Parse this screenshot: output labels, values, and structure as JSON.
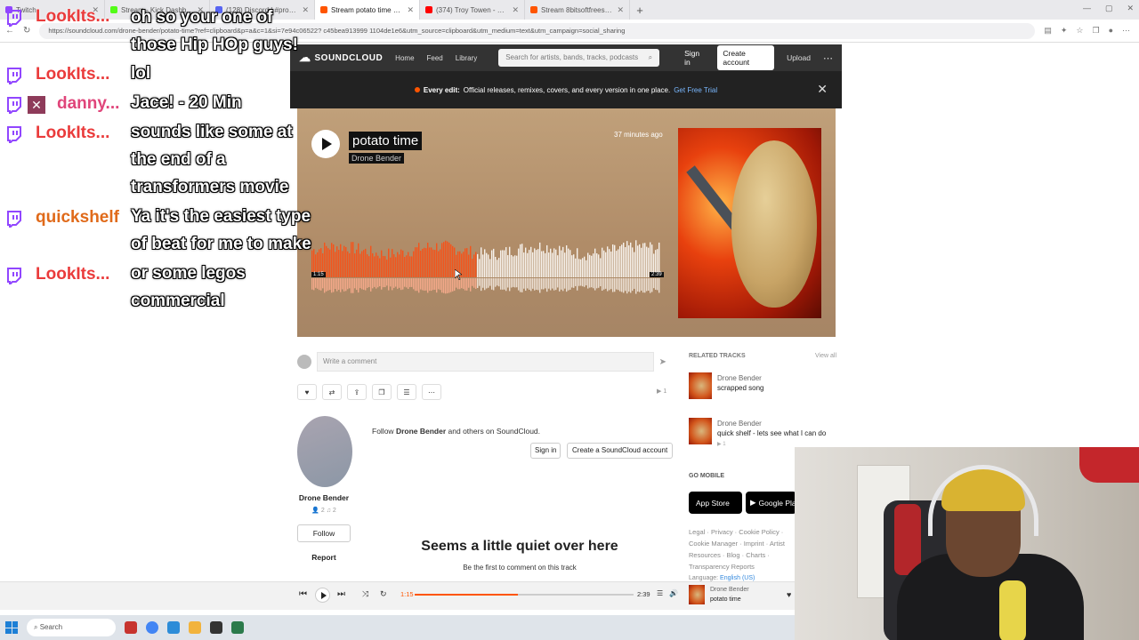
{
  "browser": {
    "tabs": [
      {
        "label": "Twitch",
        "color": "#9146ff",
        "active": false
      },
      {
        "label": "Stream - Kick Dashboard",
        "color": "#53fc18",
        "active": false
      },
      {
        "label": "(128) Discord | #promote-yourse",
        "color": "#5865f2",
        "active": false
      },
      {
        "label": "Stream potato time by Drone Ben",
        "color": "#f50",
        "active": true
      },
      {
        "label": "(374) Troy Towen - BAMBINA (Off",
        "color": "#ff0000",
        "active": false
      },
      {
        "label": "Stream 8bitsoftfreestyle by yungb",
        "color": "#f50",
        "active": false
      }
    ],
    "url": "https://soundcloud.com/drone-bender/potato-time?ref=clipboard&p=a&c=1&si=7e94c06522? c45bea913999 1104de1e6&utm_source=clipboard&utm_medium=text&utm_campaign=social_sharing"
  },
  "soundcloud": {
    "logo": "SOUNDCLOUD",
    "nav": [
      "Home",
      "Feed",
      "Library"
    ],
    "search_placeholder": "Search for artists, bands, tracks, podcasts",
    "signin": "Sign in",
    "create_account": "Create account",
    "upload": "Upload",
    "banner": {
      "bold": "Every edit:",
      "text": "Official releases, remixes, covers, and every version in one place.",
      "link": "Get Free Trial"
    },
    "track": {
      "title": "potato time",
      "artist": "Drone Bender",
      "posted": "37 minutes ago",
      "elapsed": "1:15",
      "duration": "2:39",
      "progress": 0.47
    },
    "comment_placeholder": "Write a comment",
    "plays": "▶ 1",
    "artist_name": "Drone Bender",
    "artist_stats": "👤 2   ♫ 2",
    "follow": "Follow",
    "report": "Report",
    "follow_msg_prefix": "Follow",
    "follow_msg_artist": "Drone Bender",
    "follow_msg_suffix": "and others on SoundCloud.",
    "signin_small": "Sign in",
    "create_sc": "Create a SoundCloud account",
    "quiet_title": "Seems a little quiet over here",
    "quiet_sub": "Be the first to comment on this track",
    "related_header": "RELATED TRACKS",
    "view_all": "View all",
    "related": [
      {
        "artist": "Drone Bender",
        "title": "scrapped song",
        "plays": ""
      },
      {
        "artist": "Drone Bender",
        "title": "quick shelf - lets see what I can do",
        "plays": "▶ 1"
      }
    ],
    "go_mobile": "GO MOBILE",
    "app_store": "App Store",
    "google_play": "Google Play",
    "footer_links": "Legal · Privacy · Cookie Policy · Cookie Manager · Imprint · Artist Resources · Blog · Charts · Transparency Reports",
    "language_label": "Language:",
    "language_value": "English (US)",
    "player_artist": "Drone Bender",
    "player_title": "potato time"
  },
  "chat": [
    {
      "user": "LookIts...",
      "user_color": "red",
      "lines": [
        "oh so your one of",
        "those Hip HOp guys!"
      ]
    },
    {
      "user": "LookIts...",
      "user_color": "red",
      "lines": [
        "lol"
      ]
    },
    {
      "user": "danny...",
      "user_color": "pink",
      "lines": [
        "Jace! - 20 Min"
      ]
    },
    {
      "user": "LookIts...",
      "user_color": "red",
      "lines": [
        "sounds like some at",
        "the end of a",
        "transformers movie"
      ]
    },
    {
      "user": "quickshelf",
      "user_color": "orange",
      "lines": [
        "Ya it's the easiest type",
        "of beat for me to make"
      ]
    },
    {
      "user": "LookIts...",
      "user_color": "red",
      "lines": [
        "or some legos",
        "commercial"
      ]
    }
  ],
  "taskbar": {
    "search": "Search"
  }
}
